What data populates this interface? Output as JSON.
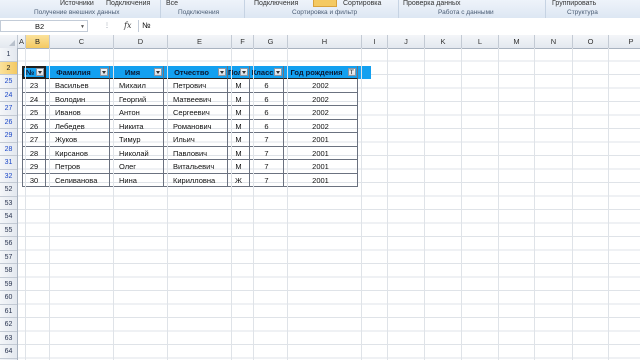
{
  "ribbon": {
    "top_items": [
      "Источники",
      "Подключения",
      "Все",
      "Подключения",
      "Сортировка",
      "Проверка данных",
      "Группировать"
    ],
    "groups": [
      "Получение внешних данных",
      "Подключения",
      "Сортировка и фильтр",
      "Работа с данными",
      "Структура"
    ]
  },
  "formula_bar": {
    "cell_ref": "B2",
    "fx": "fx",
    "content": "№"
  },
  "columns": [
    "A",
    "B",
    "C",
    "D",
    "E",
    "F",
    "G",
    "H",
    "I",
    "J",
    "K",
    "L",
    "M",
    "N",
    "O",
    "P"
  ],
  "rows": [
    "1",
    "2",
    "25",
    "24",
    "27",
    "26",
    "29",
    "28",
    "31",
    "32",
    "52",
    "53",
    "54",
    "55",
    "56",
    "57",
    "58",
    "59",
    "60",
    "61",
    "62",
    "63",
    "64"
  ],
  "table": {
    "headers": [
      "№",
      "Фамилия",
      "Имя",
      "Отчество",
      "Пол",
      "Класс",
      "Год рождения"
    ],
    "rows": [
      [
        "23",
        "Васильев",
        "Михаил",
        "Петрович",
        "М",
        "6",
        "2002"
      ],
      [
        "24",
        "Володин",
        "Георгий",
        "Матвеевич",
        "М",
        "6",
        "2002"
      ],
      [
        "25",
        "Иванов",
        "Антон",
        "Сергеевич",
        "М",
        "6",
        "2002"
      ],
      [
        "26",
        "Лебедев",
        "Никита",
        "Романович",
        "М",
        "6",
        "2002"
      ],
      [
        "27",
        "Жуков",
        "Тимур",
        "Ильич",
        "М",
        "7",
        "2001"
      ],
      [
        "28",
        "Кирсанов",
        "Николай",
        "Павлович",
        "М",
        "7",
        "2001"
      ],
      [
        "29",
        "Петров",
        "Олег",
        "Витальевич",
        "М",
        "7",
        "2001"
      ],
      [
        "30",
        "Селиванова",
        "Нина",
        "Кирилловна",
        "Ж",
        "7",
        "2001"
      ]
    ]
  },
  "colors": {
    "header_fill": "#13a0f0",
    "selected_heading": "#f4c962",
    "row_number_blue": "#1c48c8"
  }
}
